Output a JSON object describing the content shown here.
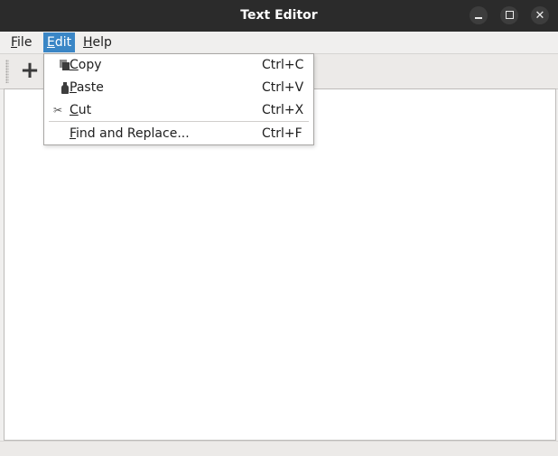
{
  "window": {
    "title": "Text Editor",
    "controls": [
      "minimize",
      "maximize",
      "close"
    ]
  },
  "menubar": {
    "items": [
      {
        "label": "File",
        "accel": "F",
        "rest": "ile",
        "active": false
      },
      {
        "label": "Edit",
        "accel": "E",
        "rest": "dit",
        "active": true
      },
      {
        "label": "Help",
        "accel": "H",
        "rest": "elp",
        "active": false
      }
    ]
  },
  "toolbar": {
    "new_button_icon": "plus-icon",
    "new_button_glyph": "+"
  },
  "edit_menu": {
    "items": [
      {
        "label": "Copy",
        "accel": "C",
        "rest": "opy",
        "shortcut": "Ctrl+C",
        "icon": "copy-icon"
      },
      {
        "label": "Paste",
        "accel": "P",
        "rest": "aste",
        "shortcut": "Ctrl+V",
        "icon": "paste-icon"
      },
      {
        "label": "Cut",
        "accel": "C",
        "rest": "ut",
        "shortcut": "Ctrl+X",
        "icon": "scissors-icon"
      },
      {
        "label": "Find and Replace...",
        "accel": "F",
        "rest": "ind and Replace...",
        "shortcut": "Ctrl+F",
        "icon": ""
      }
    ]
  },
  "editor": {
    "content": ""
  },
  "colors": {
    "titlebar": "#2b2b2b",
    "menu_highlight": "#3a86c6",
    "window_bg": "#f0efee",
    "editor_bg": "#ffffff"
  }
}
